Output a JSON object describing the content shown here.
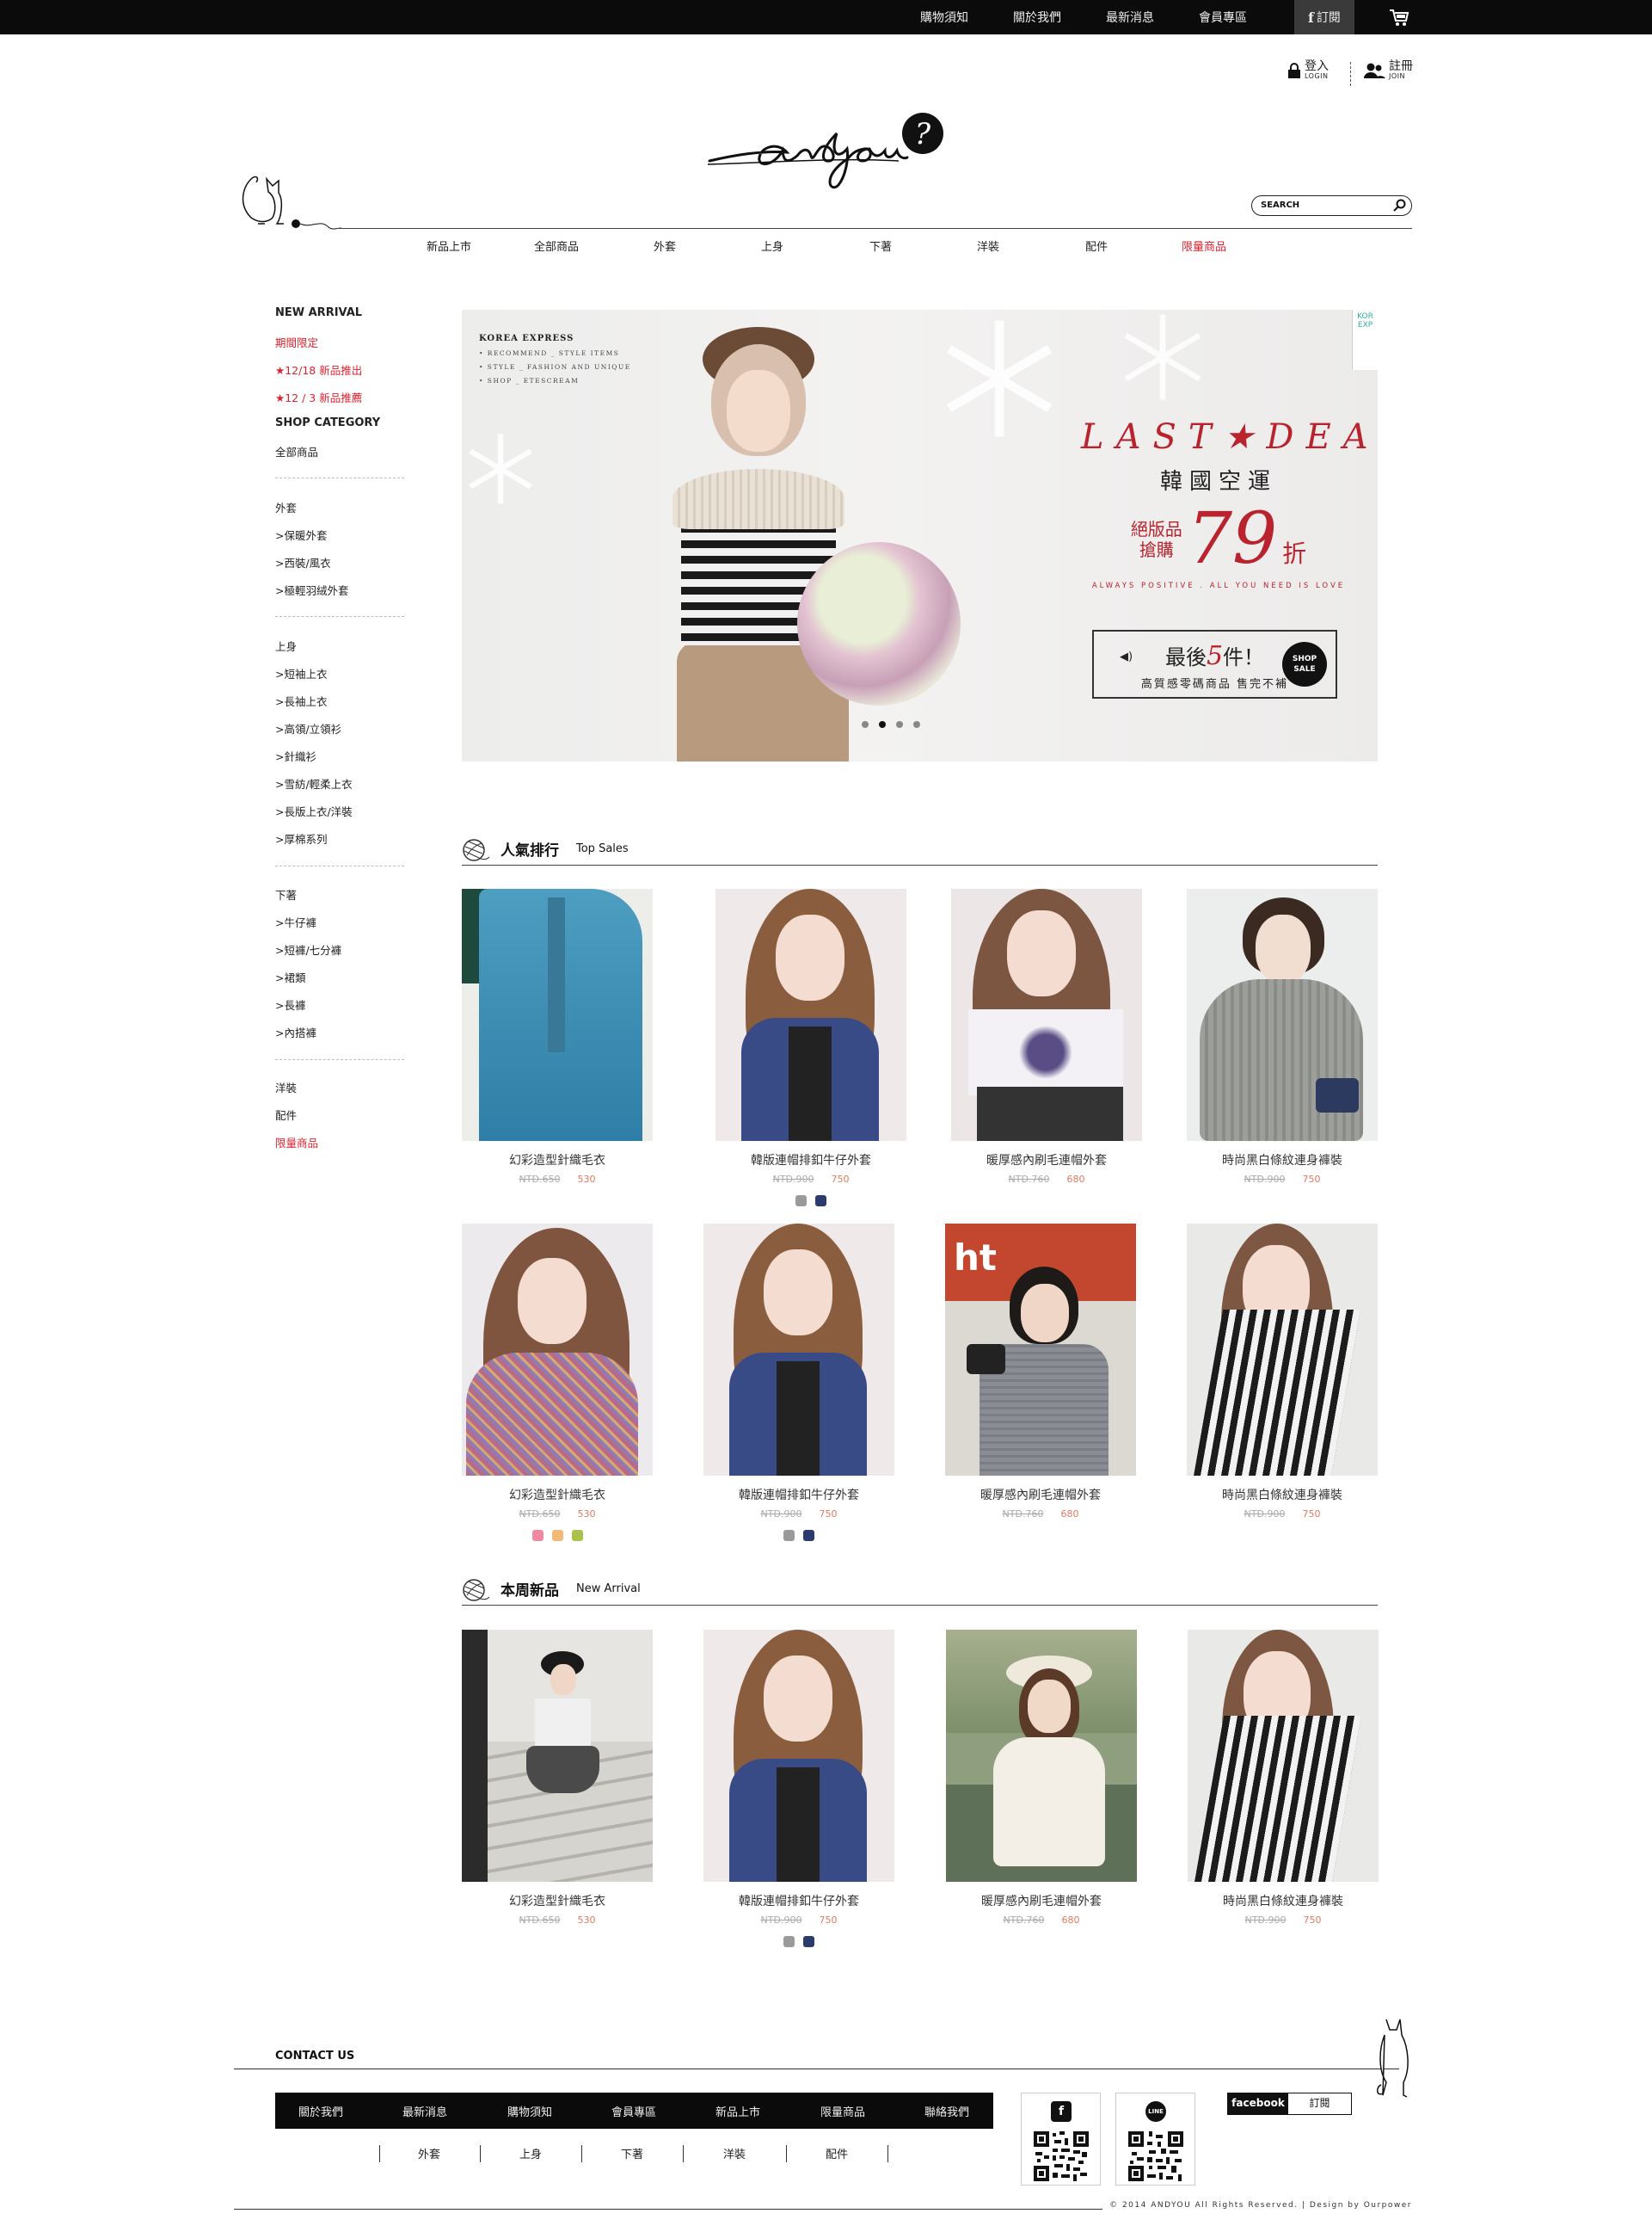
{
  "topbar": {
    "links": [
      "購物須知",
      "關於我們",
      "最新消息",
      "會員專區"
    ],
    "subscribe_label": "訂閱",
    "fb_glyph": "f",
    "cart_icon": "cart-icon"
  },
  "account": {
    "login_zh": "登入",
    "login_en": "LOGIN",
    "join_zh": "註冊",
    "join_en": "JOIN"
  },
  "search": {
    "placeholder": "SEARCH"
  },
  "nav": [
    {
      "label": "新品上市",
      "red": false
    },
    {
      "label": "全部商品",
      "red": false
    },
    {
      "label": "外套",
      "red": false
    },
    {
      "label": "上身",
      "red": false
    },
    {
      "label": "下著",
      "red": false
    },
    {
      "label": "洋裝",
      "red": false
    },
    {
      "label": "配件",
      "red": false
    },
    {
      "label": "限量商品",
      "red": true
    }
  ],
  "sidebar": {
    "new_arrival": "NEW ARRIVAL",
    "limited_time": "期間限定",
    "promo1": "★12/18 新品推出",
    "promo2": "★12 / 3 新品推薦",
    "shop_category": "SHOP CATEGORY",
    "all_products": "全部商品",
    "outer": "外套",
    "outer_items": [
      ">保暖外套",
      ">西裝/風衣",
      ">極輕羽絨外套"
    ],
    "tops": "上身",
    "tops_items": [
      ">短袖上衣",
      ">長袖上衣",
      ">高領/立領衫",
      ">針織衫",
      ">雪紡/輕柔上衣",
      ">長版上衣/洋裝",
      ">厚棉系列"
    ],
    "bottoms": "下著",
    "bottoms_items": [
      ">牛仔褲",
      ">短褲/七分褲",
      ">裙類",
      ">長褲",
      ">內搭褲"
    ],
    "dress": "洋裝",
    "accessory": "配件",
    "limited": "限量商品"
  },
  "banner": {
    "korea_title": "KOREA EXPRESS",
    "korea_lines": [
      "• RECOMMEND _ STYLE ITEMS",
      "• STYLE _ FASHION AND UNIQUE",
      "• SHOP _ ETESCREAM"
    ],
    "last_deal": "LAST★DEAL",
    "korea_air": "韓國空運",
    "promo_left_1": "絕版品",
    "promo_left_2": "搶購",
    "discount": "79",
    "discount_unit": "折",
    "motto": "ALWAYS POSITIVE . ALL YOU NEED IS LOVE",
    "last_pre": "最後",
    "last_num": "5",
    "last_post": "件！",
    "last_sub": "高質感零碼商品  售完不補",
    "shop_sale": "SHOP SALE",
    "side_tag": "KOR EXP"
  },
  "sections": {
    "top_sales_zh": "人氣排行",
    "top_sales_en": "Top Sales",
    "new_arrival_zh": "本周新品",
    "new_arrival_en": "New Arrival"
  },
  "top_sales": [
    {
      "name": "幻彩造型針織毛衣",
      "old": "NTD.650",
      "new": "530",
      "swatches": []
    },
    {
      "name": "韓版連帽排釦牛仔外套",
      "old": "NTD.900",
      "new": "750",
      "swatches": [
        "#9a9a9a",
        "#2c3b6e"
      ]
    },
    {
      "name": "暖厚感內刷毛連帽外套",
      "old": "NTD.760",
      "new": "680",
      "swatches": []
    },
    {
      "name": "時尚黑白條紋連身褲裝",
      "old": "NTD.900",
      "new": "750",
      "swatches": []
    },
    {
      "name": "幻彩造型針織毛衣",
      "old": "NTD.650",
      "new": "530",
      "swatches": [
        "#f08aa0",
        "#f2b977",
        "#a8c24a"
      ]
    },
    {
      "name": "韓版連帽排釦牛仔外套",
      "old": "NTD.900",
      "new": "750",
      "swatches": [
        "#9a9a9a",
        "#2c3b6e"
      ]
    },
    {
      "name": "暖厚感內刷毛連帽外套",
      "old": "NTD.760",
      "new": "680",
      "swatches": []
    },
    {
      "name": "時尚黑白條紋連身褲裝",
      "old": "NTD.900",
      "new": "750",
      "swatches": []
    }
  ],
  "new_arrivals": [
    {
      "name": "幻彩造型針織毛衣",
      "old": "NTD.650",
      "new": "530",
      "swatches": []
    },
    {
      "name": "韓版連帽排釦牛仔外套",
      "old": "NTD.900",
      "new": "750",
      "swatches": [
        "#9a9a9a",
        "#2c3b6e"
      ]
    },
    {
      "name": "暖厚感內刷毛連帽外套",
      "old": "NTD.760",
      "new": "680",
      "swatches": []
    },
    {
      "name": "時尚黑白條紋連身褲裝",
      "old": "NTD.900",
      "new": "750",
      "swatches": []
    }
  ],
  "footer": {
    "contact": "CONTACT US",
    "nav": [
      "關於我們",
      "最新消息",
      "購物須知",
      "會員專區",
      "新品上市",
      "限量商品",
      "聯絡我們"
    ],
    "cats": [
      "外套",
      "上身",
      "下著",
      "洋裝",
      "配件"
    ],
    "qr_fb": "f",
    "qr_line": "LINE",
    "fb_label": "facebook",
    "fb_sub": "訂閱",
    "copyright": "© 2014 ANDYOU All Rights Reserved. | Design by Ourpower"
  },
  "colors": {
    "accent_red": "#d9232e",
    "price_new": "#e07a5f",
    "price_old": "#aaaaaa",
    "bar": "#0b0b0b"
  }
}
